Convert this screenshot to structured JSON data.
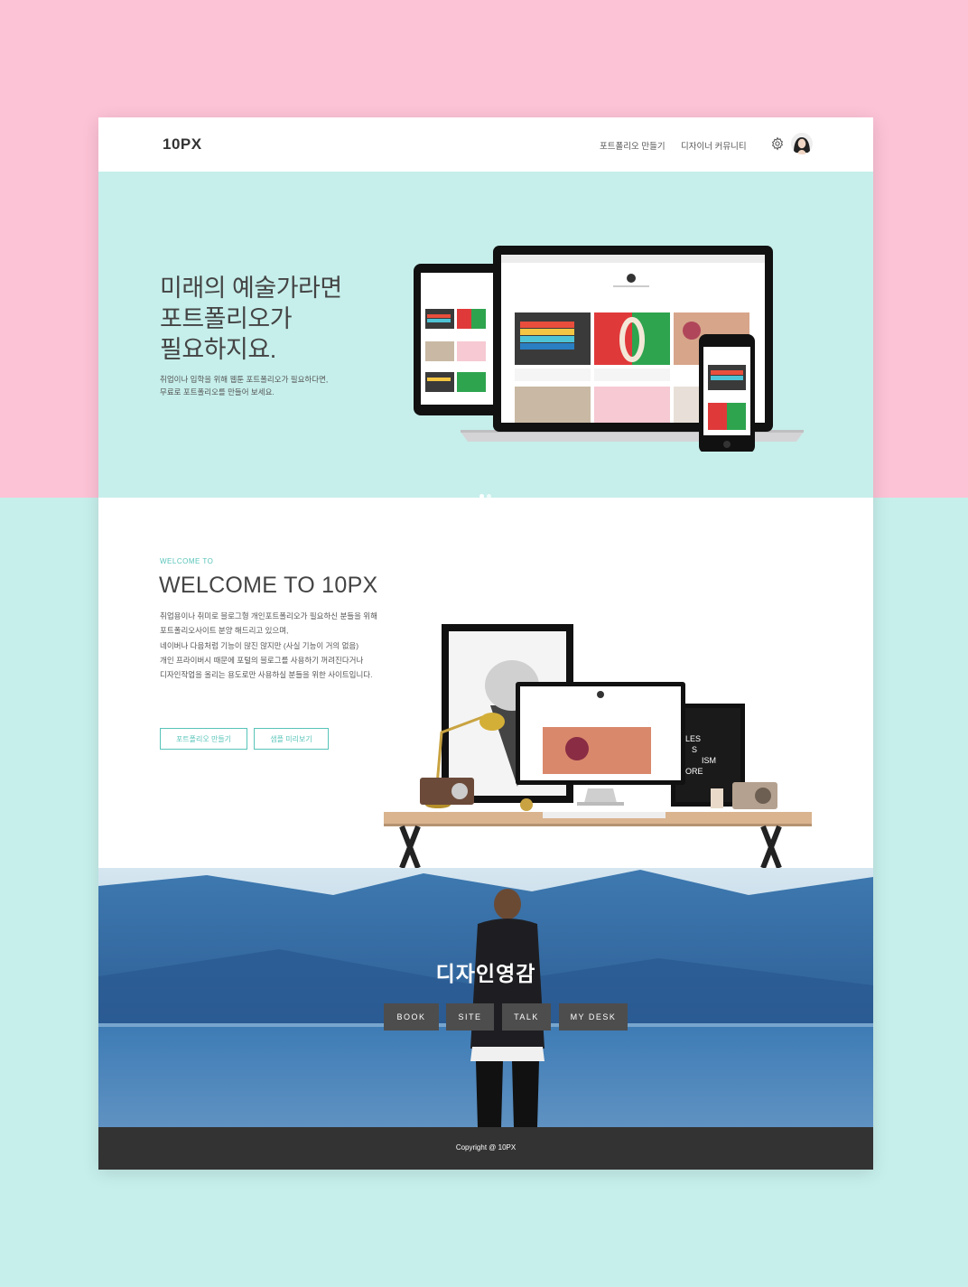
{
  "colors": {
    "pink_background": "#fcc2d5",
    "mint_background": "#c6efeb",
    "accent": "#58c4b9",
    "footer": "#333333"
  },
  "nav": {
    "logo": "10PX",
    "links": [
      "포트폴리오 만들기",
      "디자이너 커뮤니티"
    ],
    "settings_icon": "gear-icon",
    "profile_icon": "avatar"
  },
  "hero": {
    "title_lines": [
      "미래의 예술가라면",
      "포트폴리오가",
      "필요하지요."
    ],
    "desc_lines": [
      "취업이나 입학을 위해 웹툰 포트폴리오가 필요하다면,",
      "무료로 포트폴리오를 만들어 보세요."
    ],
    "slides_total": 2,
    "slide_active": 1
  },
  "welcome": {
    "eyebrow": "WELCOME TO",
    "title": "WELCOME TO 10PX",
    "desc_lines": [
      "취업용이나 취미로 블로그형 개인포트폴리오가 필요하신 분들을 위해",
      "포트폴리오사이트 분양 해드리고 있으며,",
      "네이버나 다음처럼 기능이 많진 않지만 (사실 기능이 거의 없음)",
      "개인 프라이버시 때문에 포털의 블로그를 사용하기 꺼려진다거나",
      "디자인작업을 올리는 용도로만 사용하실 분들을 위한 사이트입니다."
    ],
    "buttons": [
      "포트폴리오 만들기",
      "샘플 미리보기"
    ],
    "mockup_poster_text": [
      "LES",
      "S",
      "ISM",
      "ORE"
    ]
  },
  "inspiration": {
    "title": "디자인영감",
    "buttons": [
      "BOOK",
      "SITE",
      "TALK",
      "MY DESK"
    ]
  },
  "footer": {
    "copyright": "Copyright @ 10PX"
  }
}
